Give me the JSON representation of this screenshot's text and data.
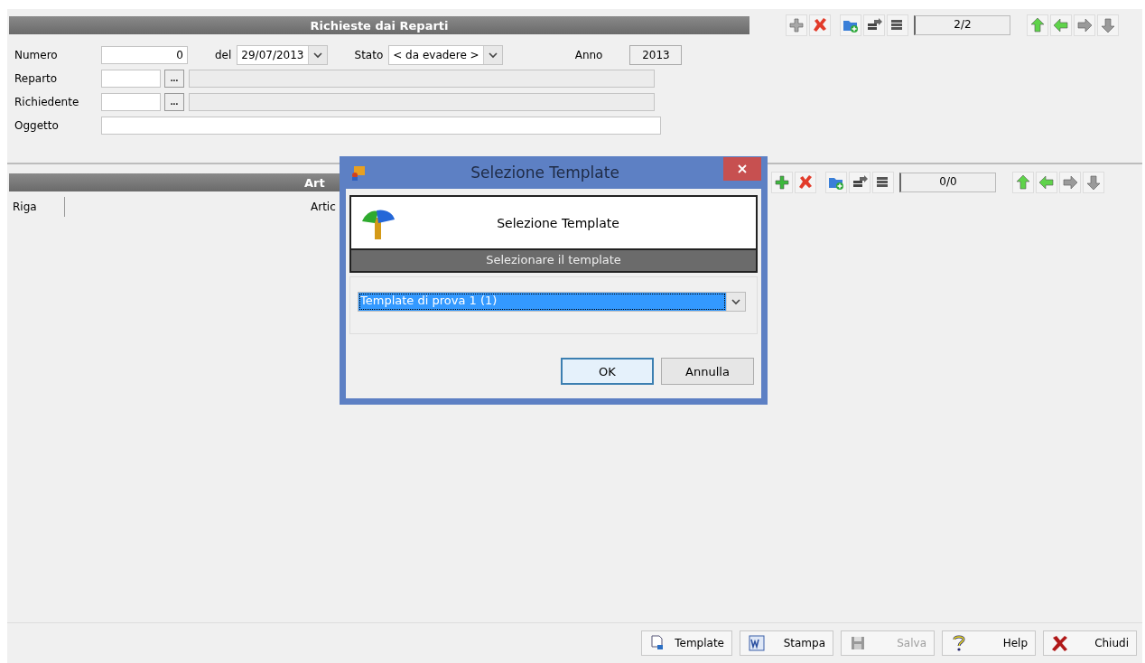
{
  "main_section": {
    "title": "Richieste dai Reparti",
    "toolbar": {
      "counter": "2/2",
      "tools": [
        {
          "kind": "add",
          "disabled": true
        },
        {
          "kind": "delete",
          "disabled": false
        },
        {
          "kind": "add-record",
          "disabled": false
        },
        {
          "kind": "export"
        },
        {
          "kind": "stack"
        },
        {
          "kind": "up",
          "disabled": false
        },
        {
          "kind": "prev",
          "disabled": false
        },
        {
          "kind": "next",
          "disabled": true
        },
        {
          "kind": "down",
          "disabled": true
        }
      ]
    },
    "numero": {
      "label": "Numero",
      "value": "0"
    },
    "data": {
      "label": "del",
      "value": "29/07/2013"
    },
    "stato": {
      "label": "Stato",
      "value": "< da evadere >"
    },
    "anno": {
      "label": "Anno",
      "value": "2013"
    },
    "reparto": {
      "label": "Reparto",
      "lookup": "..."
    },
    "richiedente": {
      "label": "Richiedente",
      "lookup": "..."
    },
    "oggetto": {
      "label": "Oggetto"
    }
  },
  "items_section": {
    "title": "Art",
    "toolbar": {
      "counter": "0/0",
      "tools": [
        {
          "kind": "add",
          "disabled": false
        },
        {
          "kind": "delete",
          "disabled": false
        },
        {
          "kind": "add-record",
          "disabled": false
        },
        {
          "kind": "export"
        },
        {
          "kind": "stack"
        },
        {
          "kind": "up",
          "disabled": false
        },
        {
          "kind": "prev",
          "disabled": false
        },
        {
          "kind": "next",
          "disabled": true
        },
        {
          "kind": "down",
          "disabled": true
        }
      ]
    },
    "columns": [
      "Riga",
      "Artic"
    ]
  },
  "dialog": {
    "title": "Selezione Template",
    "heading": "Selezione Template",
    "band": "Selezionare il template",
    "combo": {
      "value": "Template di prova 1 (1)",
      "selected": true
    },
    "buttons": [
      {
        "label": "OK",
        "selected": true
      },
      {
        "label": "Annulla",
        "selected": false
      }
    ]
  },
  "footer_buttons": [
    {
      "kind": "template",
      "label": "Template",
      "disabled": false
    },
    {
      "kind": "print",
      "label": "Stampa",
      "disabled": false
    },
    {
      "kind": "save",
      "label": "Salva",
      "disabled": true
    },
    {
      "kind": "help",
      "label": "Help",
      "disabled": false
    },
    {
      "kind": "close",
      "label": "Chiudi",
      "disabled": false
    }
  ]
}
